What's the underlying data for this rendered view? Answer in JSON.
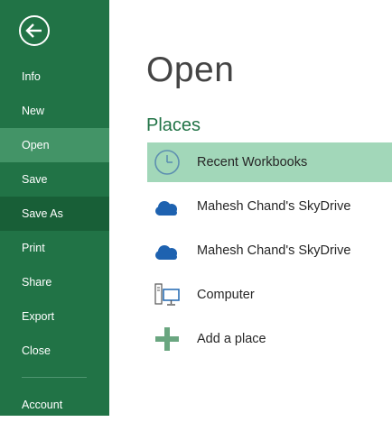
{
  "sidebar": {
    "back_icon": "back-arrow-icon",
    "items": [
      {
        "label": "Info"
      },
      {
        "label": "New"
      },
      {
        "label": "Open"
      },
      {
        "label": "Save"
      },
      {
        "label": "Save As"
      },
      {
        "label": "Print"
      },
      {
        "label": "Share"
      },
      {
        "label": "Export"
      },
      {
        "label": "Close"
      },
      {
        "label": "Account"
      }
    ],
    "active_item": "Open",
    "colors": {
      "background": "#217346",
      "active": "#439467",
      "hover": "#185f37"
    }
  },
  "main": {
    "title": "Open",
    "section_title": "Places",
    "places": [
      {
        "label": "Recent Workbooks",
        "icon": "clock-icon",
        "selected": true
      },
      {
        "label": "Mahesh Chand's SkyDrive",
        "icon": "cloud-icon"
      },
      {
        "label": "Mahesh Chand's SkyDrive",
        "icon": "cloud-icon"
      },
      {
        "label": "Computer",
        "icon": "computer-icon"
      },
      {
        "label": "Add a place",
        "icon": "plus-icon"
      }
    ],
    "colors": {
      "selected": "#a2d7b9",
      "accent": "#217346",
      "icon_blue": "#1e62b0"
    }
  }
}
